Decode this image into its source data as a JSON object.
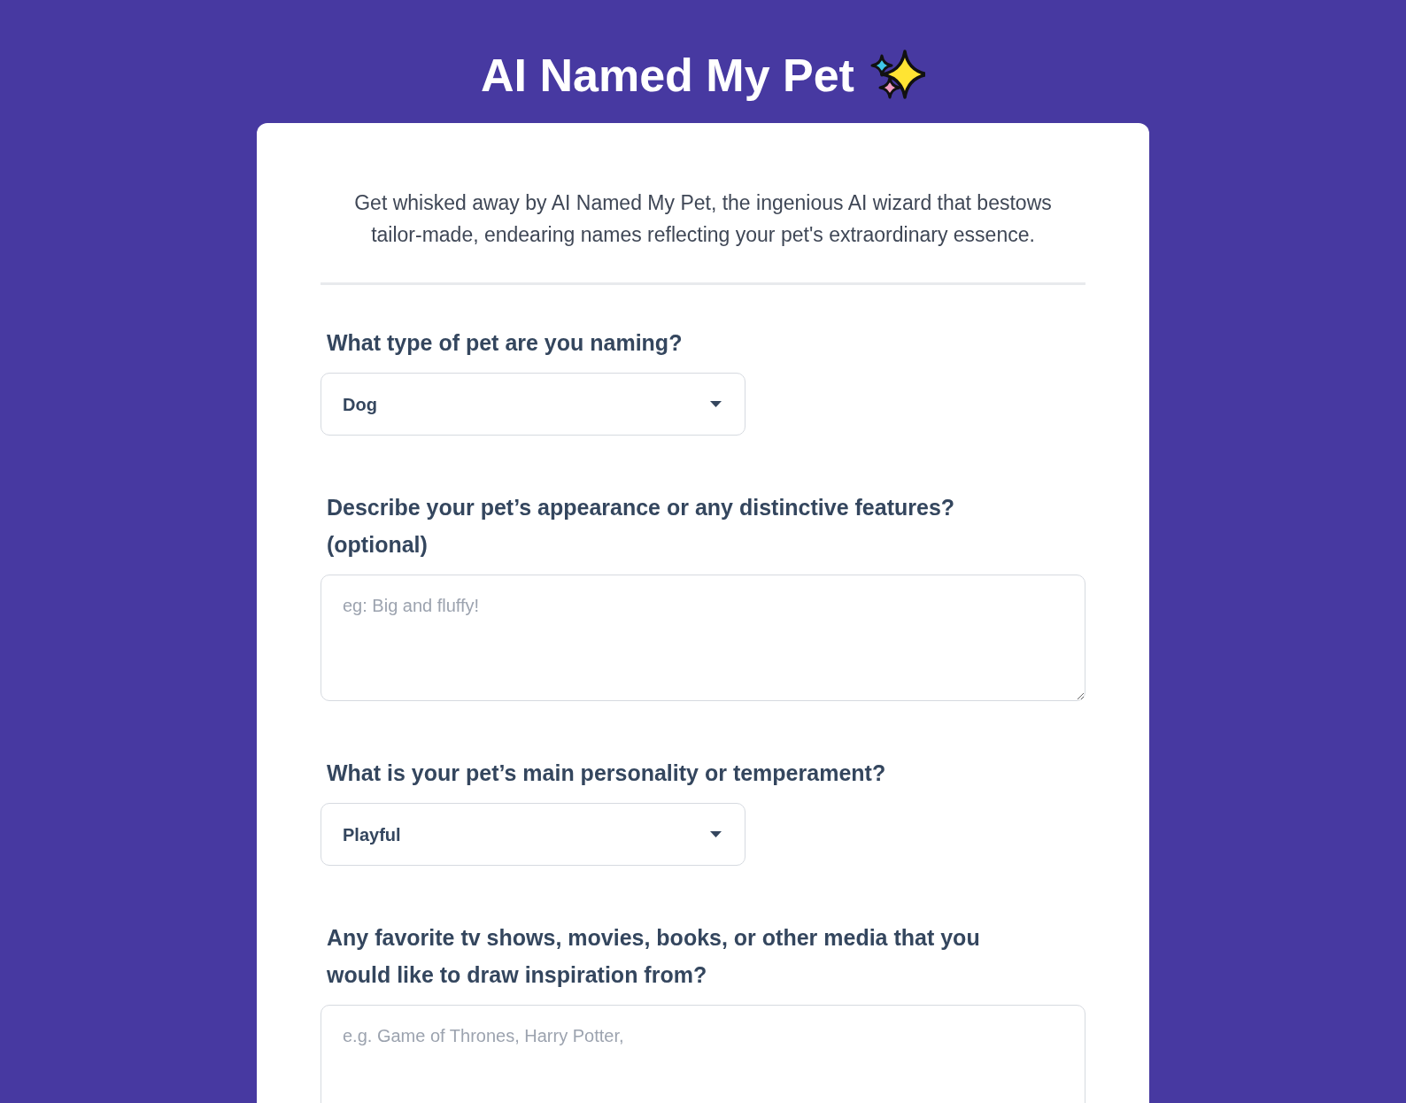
{
  "header": {
    "title": "AI Named My Pet"
  },
  "intro": "Get whisked away by AI Named My Pet, the ingenious AI wizard that bestows tailor-made, endearing names reflecting your pet's extraordinary essence.",
  "fields": [
    {
      "kind": "select",
      "label": "What type of pet are you naming?",
      "value": "Dog"
    },
    {
      "kind": "textarea",
      "label": "Describe your pet’s appearance or any distinctive features? (optional)",
      "placeholder": "eg: Big and fluffy!"
    },
    {
      "kind": "select",
      "label": "What is your pet’s main personality or temperament?",
      "value": "Playful"
    },
    {
      "kind": "textarea",
      "label": "Any favorite tv shows, movies, books, or other media that you would like to draw inspiration from?",
      "placeholder": "e.g. Game of Thrones, Harry Potter,"
    }
  ]
}
